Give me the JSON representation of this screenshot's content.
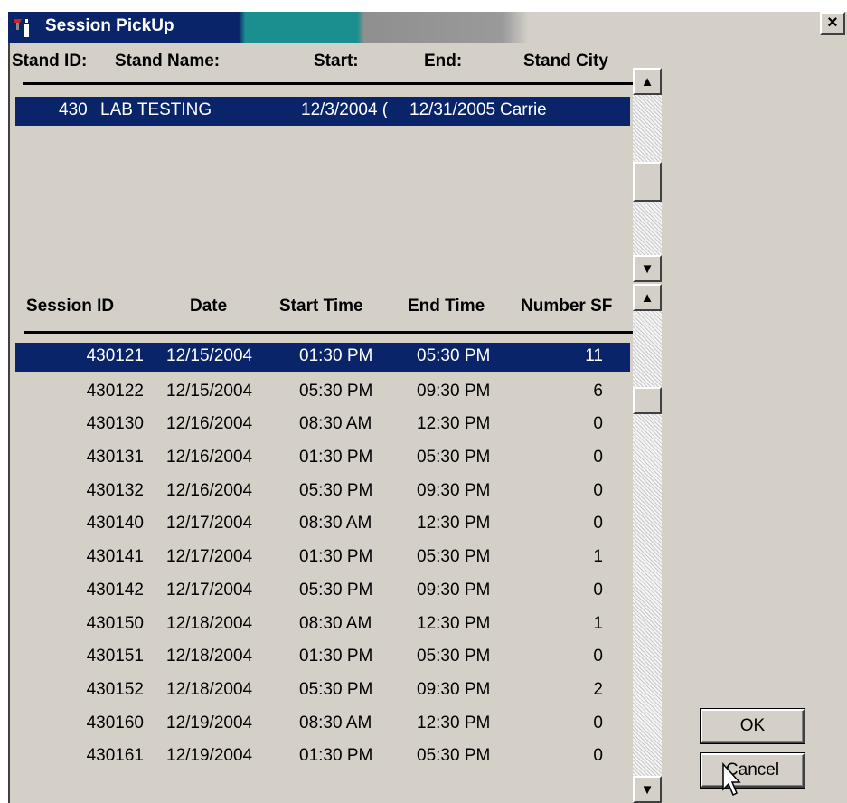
{
  "window": {
    "title": "Session PickUp",
    "close_glyph": "×"
  },
  "stands": {
    "columns": {
      "stand_id": "Stand ID:",
      "stand_name": "Stand Name:",
      "start": "Start:",
      "end": "End:",
      "stand_city": "Stand City"
    },
    "rows": [
      {
        "id": "430",
        "name": "LAB TESTING",
        "start": "12/3/2004 (",
        "end": "12/31/2005",
        "city": "Carrie"
      }
    ]
  },
  "sessions": {
    "columns": {
      "session_id": "Session ID",
      "date": "Date",
      "start_time": "Start Time",
      "end_time": "End Time",
      "number": "Number SF"
    },
    "rows": [
      {
        "id": "430121",
        "date": "12/15/2004",
        "start": "01:30 PM",
        "end": "05:30 PM",
        "num": "11"
      },
      {
        "id": "430122",
        "date": "12/15/2004",
        "start": "05:30 PM",
        "end": "09:30 PM",
        "num": "6"
      },
      {
        "id": "430130",
        "date": "12/16/2004",
        "start": "08:30 AM",
        "end": "12:30 PM",
        "num": "0"
      },
      {
        "id": "430131",
        "date": "12/16/2004",
        "start": "01:30 PM",
        "end": "05:30 PM",
        "num": "0"
      },
      {
        "id": "430132",
        "date": "12/16/2004",
        "start": "05:30 PM",
        "end": "09:30 PM",
        "num": "0"
      },
      {
        "id": "430140",
        "date": "12/17/2004",
        "start": "08:30 AM",
        "end": "12:30 PM",
        "num": "0"
      },
      {
        "id": "430141",
        "date": "12/17/2004",
        "start": "01:30 PM",
        "end": "05:30 PM",
        "num": "1"
      },
      {
        "id": "430142",
        "date": "12/17/2004",
        "start": "05:30 PM",
        "end": "09:30 PM",
        "num": "0"
      },
      {
        "id": "430150",
        "date": "12/18/2004",
        "start": "08:30 AM",
        "end": "12:30 PM",
        "num": "1"
      },
      {
        "id": "430151",
        "date": "12/18/2004",
        "start": "01:30 PM",
        "end": "05:30 PM",
        "num": "0"
      },
      {
        "id": "430152",
        "date": "12/18/2004",
        "start": "05:30 PM",
        "end": "09:30 PM",
        "num": "2"
      },
      {
        "id": "430160",
        "date": "12/19/2004",
        "start": "08:30 AM",
        "end": "12:30 PM",
        "num": "0"
      },
      {
        "id": "430161",
        "date": "12/19/2004",
        "start": "01:30 PM",
        "end": "05:30 PM",
        "num": "0"
      }
    ]
  },
  "buttons": {
    "ok": "OK",
    "cancel": "Cancel"
  },
  "icons": {
    "app": "app-icon",
    "close": "close-icon",
    "scroll_up": "scroll-up-arrow-icon",
    "scroll_down": "scroll-down-arrow-icon",
    "cursor": "mouse-pointer-icon"
  },
  "colors": {
    "selection": "#0a246a",
    "title_active": "#0a246a",
    "face": "#d4d0c8"
  }
}
